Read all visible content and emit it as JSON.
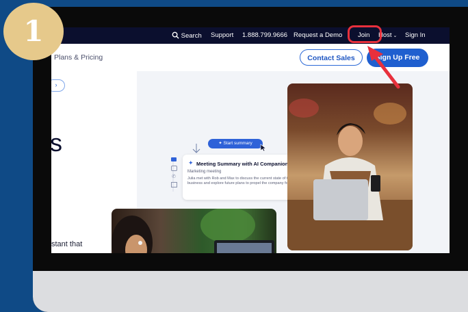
{
  "step_badge": "1",
  "topbar": {
    "search_label": "Search",
    "support_label": "Support",
    "phone": "1.888.799.9666",
    "request_demo": "Request a Demo",
    "join": "Join",
    "host": "Host",
    "sign_in": "Sign In"
  },
  "navbar": {
    "plans_pricing": "Plans & Pricing",
    "contact_sales": "Contact Sales",
    "sign_up_free": "Sign Up Free"
  },
  "hero": {
    "chip_symbol": "›",
    "big_text": "s",
    "assistant_fragment": "stant that"
  },
  "ai_card": {
    "start_summary": "Start summary",
    "title": "Meeting Summary with AI Companion",
    "subtitle": "Marketing meeting",
    "body": "Julia met with Rob and Max to discuss the current state of the business and explore future plans to propel the company forward."
  },
  "colors": {
    "accent_blue": "#1f5fcf",
    "topbar_bg": "#0b0f2e",
    "highlight_red": "#e8303c",
    "badge_gold": "#e6c98b",
    "frame_blue": "#0f4a86"
  }
}
